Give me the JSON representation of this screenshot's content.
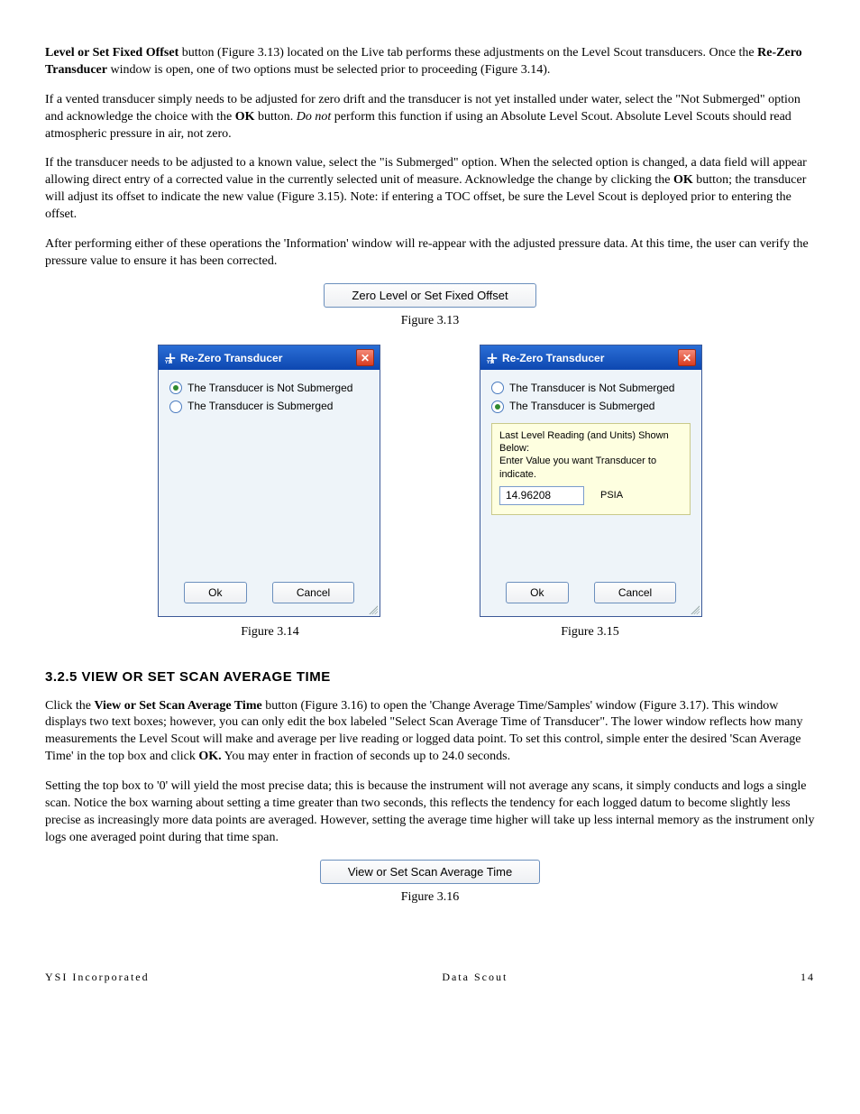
{
  "para1": {
    "b1": "Level or Set Fixed Offset",
    "t1": " button (Figure 3.13) located on the Live tab performs these adjustments on the Level Scout transducers. Once the ",
    "b2": "Re-Zero Transducer",
    "t2": " window is open, one of two options must be selected prior to proceeding (Figure 3.14)."
  },
  "para2": {
    "t1": "If a vented transducer simply needs to be adjusted for zero drift and the transducer is not yet installed under water, select the \"Not Submerged\" option and acknowledge the choice with the ",
    "b1": "OK",
    "t2": " button.  ",
    "i1": "Do not",
    "t3": " perform this function if using an Absolute Level Scout. Absolute Level Scouts should read atmospheric pressure in air, not zero."
  },
  "para3": {
    "t1": "If the transducer needs to be adjusted to a known value, select the \"is Submerged\" option. When the selected option is changed, a data field will appear allowing direct entry of a corrected value in the currently selected unit of measure.  Acknowledge the change by clicking the ",
    "b1": "OK",
    "t2": " button; the transducer will adjust its offset to indicate the new value (Figure 3.15). Note: if entering a TOC offset, be sure the Level Scout is deployed prior to entering the offset."
  },
  "para4": "After performing either of these operations the 'Information' window will re-appear with the adjusted pressure data.  At this time, the user can verify the pressure value to ensure it has been corrected.",
  "btn_zero": "Zero Level or Set Fixed Offset",
  "caption313": "Figure 3.13",
  "dialog": {
    "title": "Re-Zero Transducer",
    "opt_not": "The Transducer is Not Submerged",
    "opt_is": "The Transducer is Submerged",
    "info_line1": "Last Level Reading (and Units) Shown Below:",
    "info_line2": "Enter Value you want Transducer to indicate.",
    "value": "14.96208",
    "units": "PSIA",
    "ok": "Ok",
    "cancel": "Cancel"
  },
  "caption314": "Figure 3.14",
  "caption315": "Figure 3.15",
  "section_title": "3.2.5 VIEW OR SET SCAN AVERAGE TIME",
  "para5": {
    "t1": "Click the ",
    "b1": "View or Set Scan Average Time",
    "t2": " button (Figure 3.16) to open the 'Change Average Time/Samples' window (Figure 3.17). This window displays two text boxes; however, you can only edit the box labeled \"Select Scan Average Time of Transducer\".  The lower window reflects how many measurements the Level Scout will make and average per live reading or logged data point. To set this control, simple enter the desired 'Scan Average Time' in the top box and click ",
    "b2": "OK.",
    "t3": "  You may enter in fraction of seconds up to 24.0 seconds."
  },
  "para6": "Setting the top box to '0' will yield the most precise data; this is because the instrument will not average any scans, it simply conducts and logs a single scan.  Notice the box warning about setting a time greater than two seconds, this reflects the tendency for each logged datum to become slightly less precise as increasingly more data points are averaged.  However, setting the average time higher will take up less internal memory as the instrument only logs one averaged point during that time span.",
  "btn_scan": "View or Set Scan Average Time",
  "caption316": "Figure 3.16",
  "footer": {
    "left": "YSI Incorporated",
    "center": "Data Scout",
    "right": "14"
  }
}
